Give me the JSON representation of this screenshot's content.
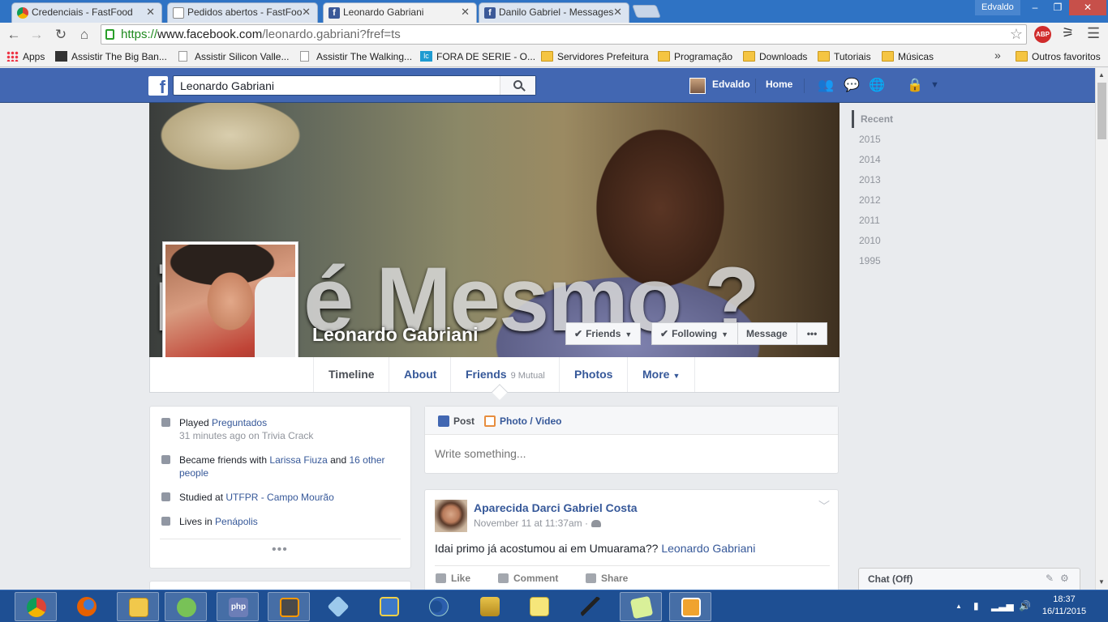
{
  "browser": {
    "tabs": [
      {
        "title": "Credenciais - FastFood",
        "favicon": "chrome-icon",
        "active": false
      },
      {
        "title": "Pedidos abertos - FastFoo",
        "favicon": "page-icon",
        "active": false
      },
      {
        "title": "Leonardo Gabriani",
        "favicon": "facebook-icon",
        "active": true
      },
      {
        "title": "Danilo Gabriel - Messages",
        "favicon": "facebook-icon",
        "active": false
      }
    ],
    "window_user": "Edvaldo",
    "url_scheme": "https://",
    "url_host": "www.facebook.com",
    "url_path": "/leonardo.gabriani?fref=ts",
    "abp_label": "ABP",
    "bookmarks": [
      {
        "label": "Apps",
        "icon": "apps-grid-icon"
      },
      {
        "label": "Assistir The Big Ban...",
        "icon": "film-icon"
      },
      {
        "label": "Assistir Silicon Valle...",
        "icon": "page-icon"
      },
      {
        "label": "Assistir The Walking...",
        "icon": "page-icon"
      },
      {
        "label": "FORA DE SERIE - O...",
        "icon": "lc-icon"
      },
      {
        "label": "Servidores Prefeitura",
        "icon": "folder-icon"
      },
      {
        "label": "Programação",
        "icon": "folder-icon"
      },
      {
        "label": "Downloads",
        "icon": "folder-icon"
      },
      {
        "label": "Tutoriais",
        "icon": "folder-icon"
      },
      {
        "label": "Músicas",
        "icon": "folder-icon"
      },
      {
        "label": "Outros favoritos",
        "icon": "folder-icon"
      }
    ],
    "bookmarks_overflow": "»"
  },
  "fb": {
    "search_value": "Leonardo Gabriani",
    "user_name": "Edvaldo",
    "home_label": "Home",
    "brand_color": "#4267b2"
  },
  "profile": {
    "name": "Leonardo Gabriani",
    "cover_caption": "im, é Mesmo ?",
    "buttons": {
      "friends": "Friends",
      "following": "Following",
      "message": "Message",
      "more_dots": "•••"
    },
    "nav": {
      "timeline": "Timeline",
      "about": "About",
      "friends": "Friends",
      "mutual": "9 Mutual",
      "photos": "Photos",
      "more": "More"
    }
  },
  "intro": {
    "played_prefix": "Played ",
    "played_game": "Preguntados",
    "played_sub": "31 minutes ago on Trivia Crack",
    "friends_prefix": "Became friends with ",
    "friends_name": "Larissa Fiuza",
    "friends_mid": " and ",
    "friends_other": "16 other people",
    "studied_prefix": "Studied at ",
    "studied_school": "UTFPR - Campo Mourão",
    "lives_prefix": "Lives in ",
    "lives_city": "Penápolis",
    "more_dots": "•••"
  },
  "composer": {
    "post_tab": "Post",
    "photo_tab": "Photo / Video",
    "placeholder": "Write something..."
  },
  "post": {
    "author": "Aparecida Darci Gabriel Costa",
    "time": "November 11 at 11:37am ·",
    "text": "Idai primo já acostumou ai em Umuarama?? ",
    "mention": "Leonardo Gabriani",
    "actions": {
      "like": "Like",
      "comment": "Comment",
      "share": "Share"
    }
  },
  "years": [
    "Recent",
    "2015",
    "2014",
    "2013",
    "2012",
    "2011",
    "2010",
    "1995"
  ],
  "chat": {
    "label": "Chat (Off)"
  },
  "taskbar": {
    "apps": [
      "chrome",
      "firefox",
      "file-explorer",
      "android-studio",
      "php",
      "sublime-text",
      "virtualbox",
      "network-tool",
      "eclipse",
      "wamp",
      "notepad",
      "pipette",
      "sticky-notes",
      "media-player"
    ],
    "time": "18:37",
    "date": "16/11/2015"
  }
}
